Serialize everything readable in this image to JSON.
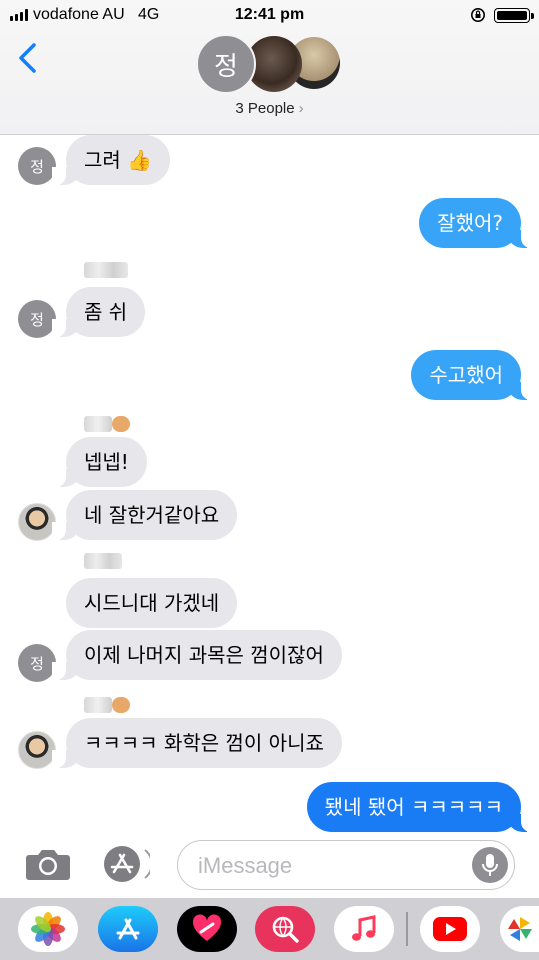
{
  "status": {
    "carrier": "vodafone AU",
    "network": "4G",
    "time": "12:41 pm"
  },
  "header": {
    "group_initial": "정",
    "people_label": "3 People",
    "chevron": "›"
  },
  "messages": {
    "m1": "그려 👍",
    "m2": "잘했어?",
    "m3": "좀 쉬",
    "m4": "수고했어",
    "m5": "넵넵!",
    "m6": "네 잘한거같아요",
    "m7": "시드니대 가겠네",
    "m8": "이제 나머지 과목은 껌이잖어",
    "m9": "ㅋㅋㅋㅋ 화학은 껌이 아니죠",
    "m10": "됐네 됐어 ㅋㅋㅋㅋㅋ"
  },
  "avatar_initial": "정",
  "input": {
    "placeholder": "iMessage"
  },
  "icons": [
    "back-chevron-icon",
    "camera-icon",
    "app-store-icon",
    "microphone-icon",
    "photos-icon",
    "app-store-icon",
    "digital-touch-icon",
    "web-search-icon",
    "music-icon",
    "youtube-icon",
    "pinwheel-icon"
  ],
  "colors": {
    "outgoing": "#37a4f7",
    "outgoing_last": "#1a7cf5",
    "incoming": "#e6e6eb",
    "accent": "#157efb"
  }
}
